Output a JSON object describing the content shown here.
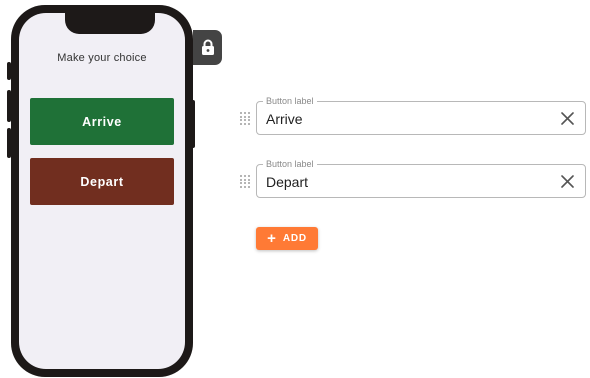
{
  "phone": {
    "prompt": "Make your choice",
    "buttons": [
      {
        "label": "Arrive",
        "color": "#1f7137"
      },
      {
        "label": "Depart",
        "color": "#712e1f"
      }
    ],
    "lock_icon": "lock-icon"
  },
  "editor": {
    "fields": [
      {
        "legend": "Button label",
        "value": "Arrive"
      },
      {
        "legend": "Button label",
        "value": "Depart"
      }
    ],
    "drag_icon": "drag-handle-icon",
    "clear_icon": "close-icon",
    "add_button": {
      "icon": "+",
      "label": "ADD",
      "color": "#ff7a35"
    }
  }
}
